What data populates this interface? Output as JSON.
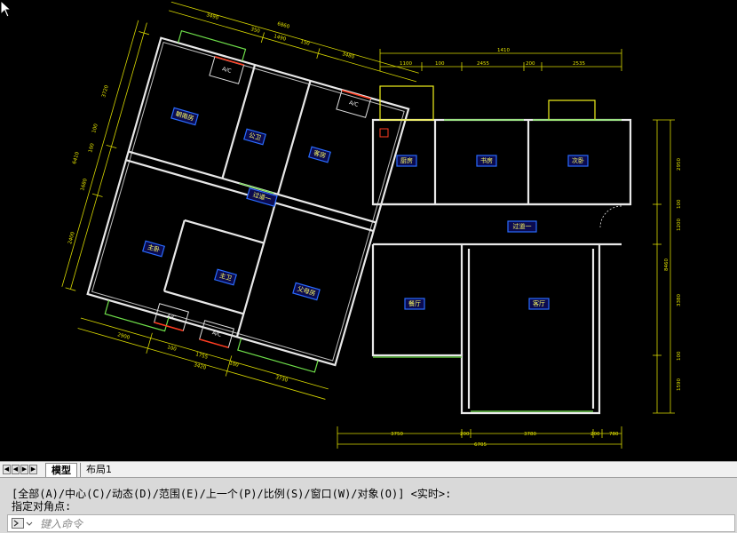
{
  "drawing": {
    "rooms": [
      {
        "id": "master-bedroom-top",
        "label": "朝南房"
      },
      {
        "id": "bathroom-public",
        "label": "公卫"
      },
      {
        "id": "bedroom-2",
        "label": "客房"
      },
      {
        "id": "corridor-1",
        "label": "过道一"
      },
      {
        "id": "master-bedroom",
        "label": "主卧"
      },
      {
        "id": "bathroom-master",
        "label": "主卫"
      },
      {
        "id": "study-child",
        "label": "父母房"
      },
      {
        "id": "kitchen",
        "label": "厨房"
      },
      {
        "id": "study",
        "label": "书房"
      },
      {
        "id": "bedroom-3",
        "label": "次卧"
      },
      {
        "id": "corridor-2",
        "label": "过道一"
      },
      {
        "id": "dining",
        "label": "餐厅"
      },
      {
        "id": "living",
        "label": "客厅"
      }
    ],
    "ac_units": [
      "A/C",
      "A/C",
      "A/C",
      "A/C"
    ],
    "dims_top_left": [
      "3490",
      "6860",
      "350",
      "1490",
      "150",
      "3480"
    ],
    "dims_top_right": [
      "1410",
      "1100",
      "100",
      "2455",
      "200",
      "2535"
    ],
    "dims_left": [
      "3720",
      "100",
      "100",
      "6410",
      "1680",
      "2400"
    ],
    "dims_bottom_left": [
      "2900",
      "100",
      "1755",
      "3420",
      "100",
      "3730"
    ],
    "dims_right": [
      "2950",
      "100",
      "1200",
      "8460",
      "3380",
      "100",
      "1590"
    ],
    "dims_bottom_right": [
      "3750",
      "200",
      "3780",
      "200",
      "780",
      "6705"
    ]
  },
  "tabs": {
    "nav": [
      "◀",
      "◀",
      "▶",
      "▶"
    ],
    "model": "模型",
    "layout1": "布局1"
  },
  "command": {
    "history_1": "[全部(A)/中心(C)/动态(D)/范围(E)/上一个(P)/比例(S)/窗口(W)/对象(O)] <实时>:",
    "history_2": "指定对角点:",
    "input_placeholder": "键入命令",
    "input_value": ""
  },
  "colors": {
    "background": "#000000",
    "wall": "#e8e8e8",
    "dimension": "#d8d800",
    "balcony": "#6fe04a",
    "label_border": "#2a6bff",
    "label_text": "#ffff66"
  }
}
